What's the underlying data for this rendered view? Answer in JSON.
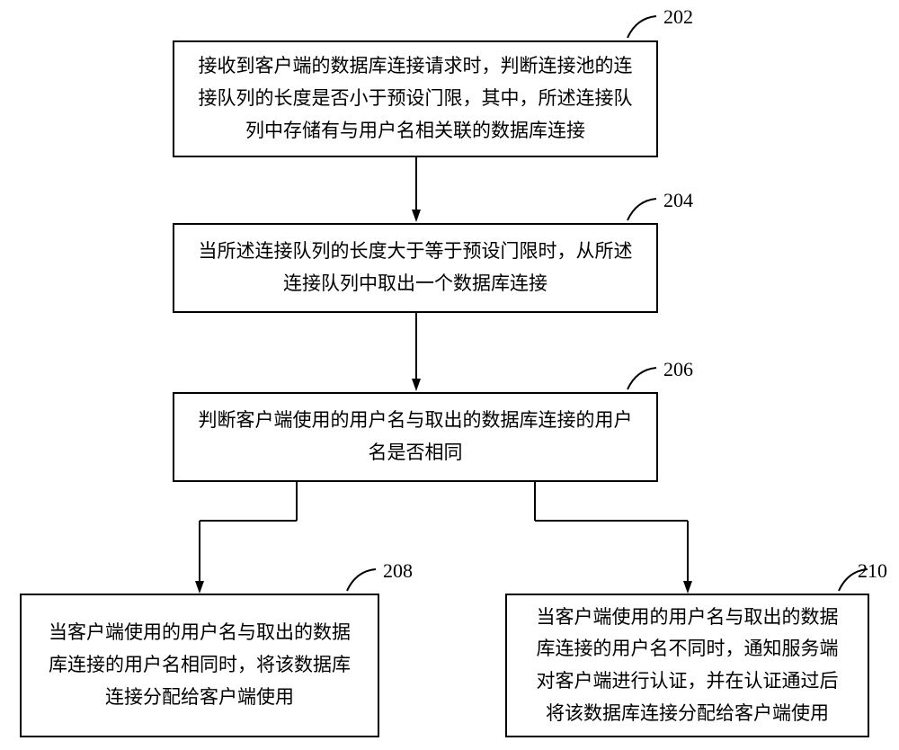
{
  "chart_data": {
    "type": "flowchart",
    "nodes": [
      {
        "id": "202",
        "label": "接收到客户端的数据库连接请求时，判断连接池的连接队列的长度是否小于预设门限，其中，所述连接队列中存储有与用户名相关联的数据库连接"
      },
      {
        "id": "204",
        "label": "当所述连接队列的长度大于等于预设门限时，从所述连接队列中取出一个数据库连接"
      },
      {
        "id": "206",
        "label": "判断客户端使用的用户名与取出的数据库连接的用户名是否相同"
      },
      {
        "id": "208",
        "label": "当客户端使用的用户名与取出的数据库连接的用户名相同时，将该数据库连接分配给客户端使用"
      },
      {
        "id": "210",
        "label": "当客户端使用的用户名与取出的数据库连接的用户名不同时，通知服务端对客户端进行认证，并在认证通过后将该数据库连接分配给客户端使用"
      }
    ],
    "edges": [
      {
        "from": "202",
        "to": "204"
      },
      {
        "from": "204",
        "to": "206"
      },
      {
        "from": "206",
        "to": "208"
      },
      {
        "from": "206",
        "to": "210"
      }
    ]
  },
  "boxes": {
    "b202": {
      "num": "202",
      "text": "接收到客户端的数据库连接请求时，判断连接池的连接队列的长度是否小于预设门限，其中，所述连接队列中存储有与用户名相关联的数据库连接"
    },
    "b204": {
      "num": "204",
      "text": "当所述连接队列的长度大于等于预设门限时，从所述连接队列中取出一个数据库连接"
    },
    "b206": {
      "num": "206",
      "text": "判断客户端使用的用户名与取出的数据库连接的用户名是否相同"
    },
    "b208": {
      "num": "208",
      "text": "当客户端使用的用户名与取出的数据库连接的用户名相同时，将该数据库连接分配给客户端使用"
    },
    "b210": {
      "num": "210",
      "text": "当客户端使用的用户名与取出的数据库连接的用户名不同时，通知服务端对客户端进行认证，并在认证通过后将该数据库连接分配给客户端使用"
    }
  }
}
